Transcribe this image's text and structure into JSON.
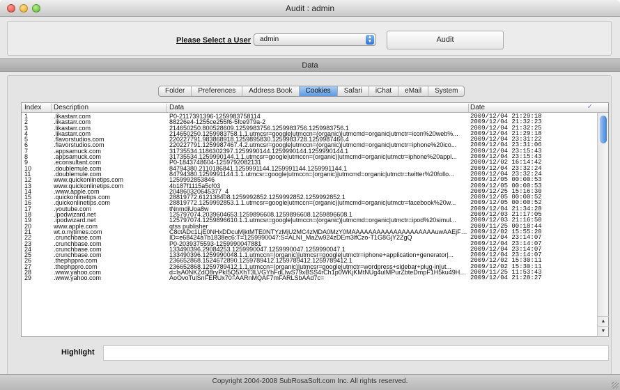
{
  "window": {
    "title": "Audit : admin"
  },
  "user_panel": {
    "select_label": "Please Select a User",
    "selected_user": "admin",
    "audit_button": "Audit"
  },
  "data_section": {
    "header": "Data"
  },
  "tabs": [
    {
      "label": "Folder",
      "selected": false
    },
    {
      "label": "Preferences",
      "selected": false
    },
    {
      "label": "Address Book",
      "selected": false
    },
    {
      "label": "Cookies",
      "selected": true
    },
    {
      "label": "Safari",
      "selected": false
    },
    {
      "label": "iChat",
      "selected": false
    },
    {
      "label": "eMail",
      "selected": false
    },
    {
      "label": "System",
      "selected": false
    }
  ],
  "table": {
    "columns": {
      "index": "Index",
      "description": "Description",
      "data": "Data",
      "date": "Date"
    },
    "rows": [
      {
        "index": "1",
        "description": ".likastarr.com",
        "data": "P0-2117391396-1259983758114",
        "date": "2009/12/04 21:29:18"
      },
      {
        "index": "2",
        "description": ".likastarr.com",
        "data": "88226e4-1255ce255f6-5fce979a-2",
        "date": "2009/12/04 21:32:23"
      },
      {
        "index": "3",
        "description": ".likastarr.com",
        "data": "214650250.800528609.1259983756.1259983756.1259983756.1",
        "date": "2009/12/04 21:32:25"
      },
      {
        "index": "4",
        "description": ".likastarr.com",
        "data": "214650250.1259983758.1.1.utmcsr=google|utmccn=(organic)|utmcmd=organic|utmctr=icon%20web%...",
        "date": "2009/12/04 21:29:18"
      },
      {
        "index": "5",
        "description": ".flavorstudios.com",
        "data": "220227791.983868918.1259895830.1259983728.1259987466.4",
        "date": "2009/12/04 23:31:22"
      },
      {
        "index": "6",
        "description": ".flavorstudios.com",
        "data": "220227791.1259987467.4.2.utmcsr=google|utmccn=(organic)|utmcmd=organic|utmctr=iphone%20ico...",
        "date": "2009/12/04 23:31:06"
      },
      {
        "index": "7",
        "description": ".appsamuck.com",
        "data": "31735534.1186302397.1259990144.1259990144.1259990144.1",
        "date": "2009/12/04 23:15:43"
      },
      {
        "index": "8",
        "description": ".appsamuck.com",
        "data": "31735534.1259990144.1.1.utmcsr=google|utmccn=(organic)|utmcmd=organic|utmctr=iphone%20appl...",
        "date": "2009/12/04 23:15:43"
      },
      {
        "index": "9",
        "description": ".econsultant.com",
        "data": "P0-1843748604-1259792082131",
        "date": "2009/12/02 16:14:42"
      },
      {
        "index": "10",
        "description": ".doublemule.com",
        "data": "84794380.2110186841.1259991144.1259991144.1259991144.1",
        "date": "2009/12/04 23:32:24"
      },
      {
        "index": "11",
        "description": ".doublemule.com",
        "data": "84794380.1259991144.1.1.utmcsr=google|utmccn=(organic)|utmcmd=organic|utmctr=twitter%20follo...",
        "date": "2009/12/04 23:32:24"
      },
      {
        "index": "12",
        "description": "www.quickonlinetips.com",
        "data": "1259992853846",
        "date": "2009/12/05 00:00:53"
      },
      {
        "index": "13",
        "description": "www.quickonlinetips.com",
        "data": "4b187f1115a5cf03",
        "date": "2009/12/05 00:00:53"
      },
      {
        "index": "14",
        "description": ".www.apple.com",
        "data": "204860320645377_4",
        "date": "2009/12/25 15:16:30"
      },
      {
        "index": "15",
        "description": ".quickonlinetips.com",
        "data": "28819772.612138408.1259992852.1259992852.1259992852.1",
        "date": "2009/12/05 00:00:52"
      },
      {
        "index": "16",
        "description": ".quickonlinetips.com",
        "data": "28819772.1259992853.1.1.utmcsr=google|utmccn=(organic)|utmcmd=organic|utmctr=facebook%20w...",
        "date": "2009/12/05 00:00:52"
      },
      {
        "index": "17",
        "description": ".youtube.com",
        "data": "tNnmdiUoa8w",
        "date": "2009/12/04 21:34:28"
      },
      {
        "index": "18",
        "description": ".ipodwizard.net",
        "data": "125797074.2039604653.1259896608.1259896608.1259896608.1",
        "date": "2009/12/03 21:17:05"
      },
      {
        "index": "19",
        "description": ".ipodwizard.net",
        "data": "125797074.1259896610.1.1.utmcsr=google|utmccn=(organic)|utmcmd=organic|utmctr=ipod%20simul...",
        "date": "2009/12/03 21:16:50"
      },
      {
        "index": "20",
        "description": "www.apple.com",
        "data": "qtss publisher",
        "date": "2009/11/25 00:18:44"
      },
      {
        "index": "21",
        "description": "wt.o.nytimes.com",
        "data": "C8ctADc1LjE0NHxDDcuMjktMTE0NTYzMjU2MC4zMDA0MzY0MAAAAAAAAAAAAAAAAAAAAuwAAEjFkt4hZL...",
        "date": "2009/12/02 15:55:20"
      },
      {
        "index": "22",
        "description": ".crunchbase.com",
        "data": "ID=e68424a7b1838ec6:T=1259990047:S=ALNI_MaZw924zDEm3lfCzo-T1G8GjY2ZgQ",
        "date": "2009/12/04 23:14:07"
      },
      {
        "index": "23",
        "description": ".crunchbase.com",
        "data": "P0-2039375593-1259990047881",
        "date": "2009/12/04 23:14:07"
      },
      {
        "index": "24",
        "description": ".crunchbase.com",
        "data": "133490396.29084253.1259990047.1259990047.1259990047.1",
        "date": "2009/12/04 23:14:07"
      },
      {
        "index": "25",
        "description": ".crunchbase.com",
        "data": "133490396.1259990048.1.1.utmccn=(organic)|utmcsr=google|utmctr=iphone+application+generator|...",
        "date": "2009/12/04 23:14:07"
      },
      {
        "index": "26",
        "description": ".thephppro.com",
        "data": "236652868.1524672890.1259789412.1259789412.1259789412.1",
        "date": "2009/12/02 15:30:11"
      },
      {
        "index": "27",
        "description": ".thephppro.com",
        "data": "236652868.1259789412.1.1.utmccn=(organic)|utmcsr=google|utmctr=wordpress+sidebar+plug-in|ut...",
        "date": "2009/12/02 15:30:11"
      },
      {
        "index": "28",
        "description": ".www.yahoo.com",
        "data": "d=lsA0NKZdQ8ryPkI5Q5XhT3LVGYhFdLIwS79xBSS4rCh1p0WKjKMtNUg4uIMPurZbteDmpF1H5ku49H6...",
        "date": "2009/11/25 11:53:43"
      },
      {
        "index": "29",
        "description": ".www.yahoo.com",
        "data": "AoOvoTulSnFERUx70=AARnMQAF7mFARLSbAAd7c=",
        "date": "2009/12/04 21:28:27"
      }
    ]
  },
  "highlight": {
    "label": "Highlight",
    "value": ""
  },
  "footer": {
    "text": "Copyright 2004-2008 SubRosaSoft.com Inc. All rights reserved."
  },
  "colors": {
    "tab_selected": "#5d9ae0",
    "scroll_thumb": "#3f82d8"
  }
}
